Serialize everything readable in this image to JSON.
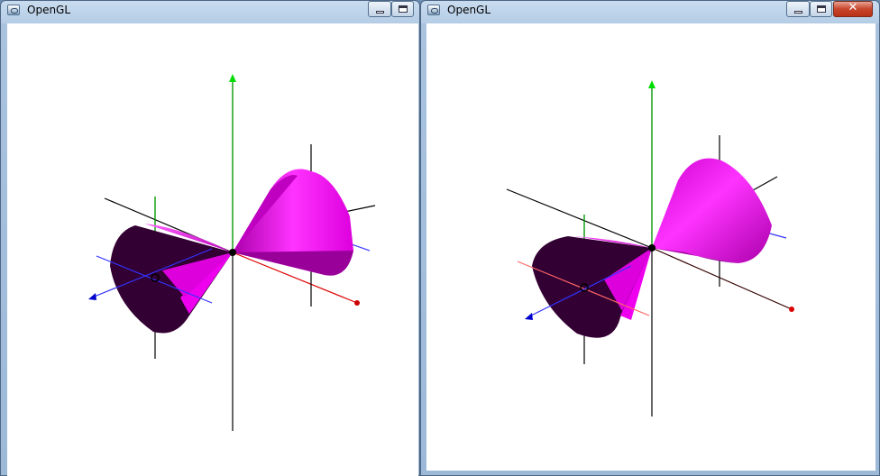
{
  "windows": [
    {
      "title": "OpenGL",
      "icon": "opengl-app-icon",
      "controls": [
        "minimize-icon",
        "maximize-icon"
      ]
    },
    {
      "title": "OpenGL",
      "icon": "opengl-app-icon",
      "controls": [
        "minimize-icon",
        "maximize-icon",
        "close-icon"
      ],
      "close_glyph": "✕"
    }
  ],
  "colors": {
    "cone_light": "#ff00ff",
    "cone_dark": "#330033",
    "axis_x": "#ff0000",
    "axis_y": "#00ff00",
    "axis_z": "#0000ff",
    "axis_black": "#000000",
    "background": "#ffffff"
  }
}
